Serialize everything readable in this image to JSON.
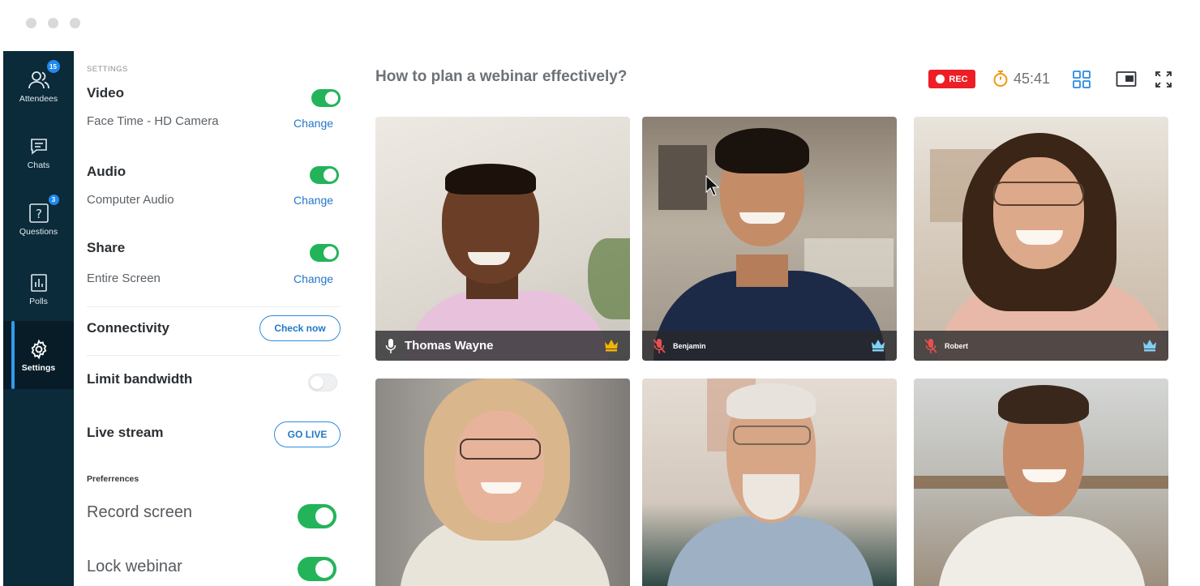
{
  "sidebar": {
    "items": [
      {
        "label": "Attendees",
        "badge": "15",
        "icon": "attendees-icon"
      },
      {
        "label": "Chats",
        "icon": "chat-icon"
      },
      {
        "label": "Questions",
        "badge": "3",
        "icon": "question-icon"
      },
      {
        "label": "Polls",
        "icon": "poll-icon"
      },
      {
        "label": "Settings",
        "icon": "gear-icon",
        "active": true
      }
    ]
  },
  "settings": {
    "caption": "SETTINGS",
    "video": {
      "title": "Video",
      "device": "Face Time - HD Camera",
      "change": "Change",
      "enabled": true
    },
    "audio": {
      "title": "Audio",
      "device": "Computer Audio",
      "change": "Change",
      "enabled": true
    },
    "share": {
      "title": "Share",
      "device": "Entire Screen",
      "change": "Change",
      "enabled": true
    },
    "connectivity": {
      "title": "Connectivity",
      "button": "Check now"
    },
    "bandwidth": {
      "title": "Limit bandwidth",
      "enabled": false
    },
    "livestream": {
      "title": "Live stream",
      "button": "GO LIVE"
    },
    "preferences": {
      "caption": "Preferrences",
      "record": {
        "title": "Record screen",
        "enabled": true
      },
      "lock": {
        "title": "Lock webinar",
        "enabled": true
      }
    }
  },
  "meeting": {
    "title": "How to plan a webinar effectively?",
    "rec_label": "REC",
    "timer": "45:41"
  },
  "participants": [
    {
      "name": "Thomas Wayne",
      "mic": "on"
    },
    {
      "name": "Benjamin",
      "mic": "muted"
    },
    {
      "name": "Robert",
      "mic": "muted"
    }
  ],
  "colors": {
    "rail": "#0b2a3a",
    "accent": "#2b8be0",
    "toggle_on": "#23b45a",
    "rec": "#ee1e26",
    "crown_gold": "#f5b301",
    "crown_blue": "#7fd0f5"
  }
}
